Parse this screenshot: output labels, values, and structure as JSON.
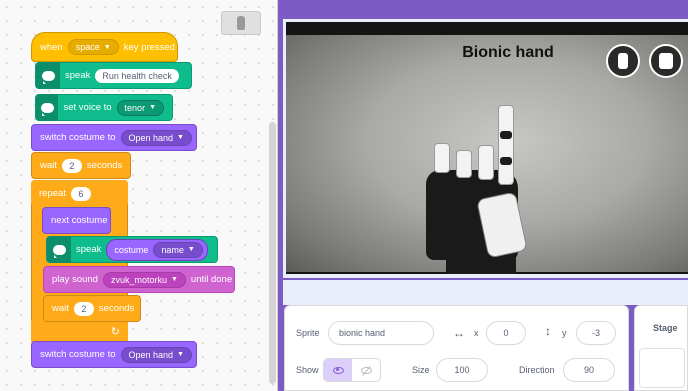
{
  "script": {
    "hat": {
      "when": "when",
      "key": "space",
      "key_pressed": "key pressed"
    },
    "speak1": {
      "label": "speak",
      "text": "Run health check"
    },
    "voice": {
      "label": "set voice to",
      "value": "tenor"
    },
    "switch1": {
      "label": "switch costume to",
      "value": "Open hand"
    },
    "wait1": {
      "label": "wait",
      "value": "2",
      "unit": "seconds"
    },
    "repeat": {
      "label": "repeat",
      "value": "6"
    },
    "next": {
      "label": "next costume"
    },
    "speak2": {
      "label": "speak",
      "reporter": "costume",
      "reporter_value": "name"
    },
    "play": {
      "label": "play sound",
      "value": "zvuk_motorku",
      "until": "until done"
    },
    "wait2": {
      "label": "wait",
      "value": "2",
      "unit": "seconds"
    },
    "switch2": {
      "label": "switch costume to",
      "value": "Open hand"
    }
  },
  "stage": {
    "title": "Bionic hand"
  },
  "sprite_info": {
    "sprite_label": "Sprite",
    "sprite_name": "bionic hand",
    "x_label": "x",
    "x_value": "0",
    "y_label": "y",
    "y_value": "-3",
    "show_label": "Show",
    "size_label": "Size",
    "size_value": "100",
    "direction_label": "Direction",
    "direction_value": "90"
  },
  "stage_panel": {
    "label": "Stage"
  },
  "icons": {
    "move_x": "horizontal-arrows-icon",
    "move_y": "vertical-arrows-icon",
    "show": "eye-icon",
    "hide": "eye-slash-icon",
    "loop_arrow": "loop-arrow-icon"
  },
  "colors": {
    "events": "#ffbf00",
    "tts": "#0fbd8c",
    "looks": "#9966ff",
    "control": "#ffab19",
    "sound": "#cf63cf",
    "accent": "#855cd6"
  }
}
